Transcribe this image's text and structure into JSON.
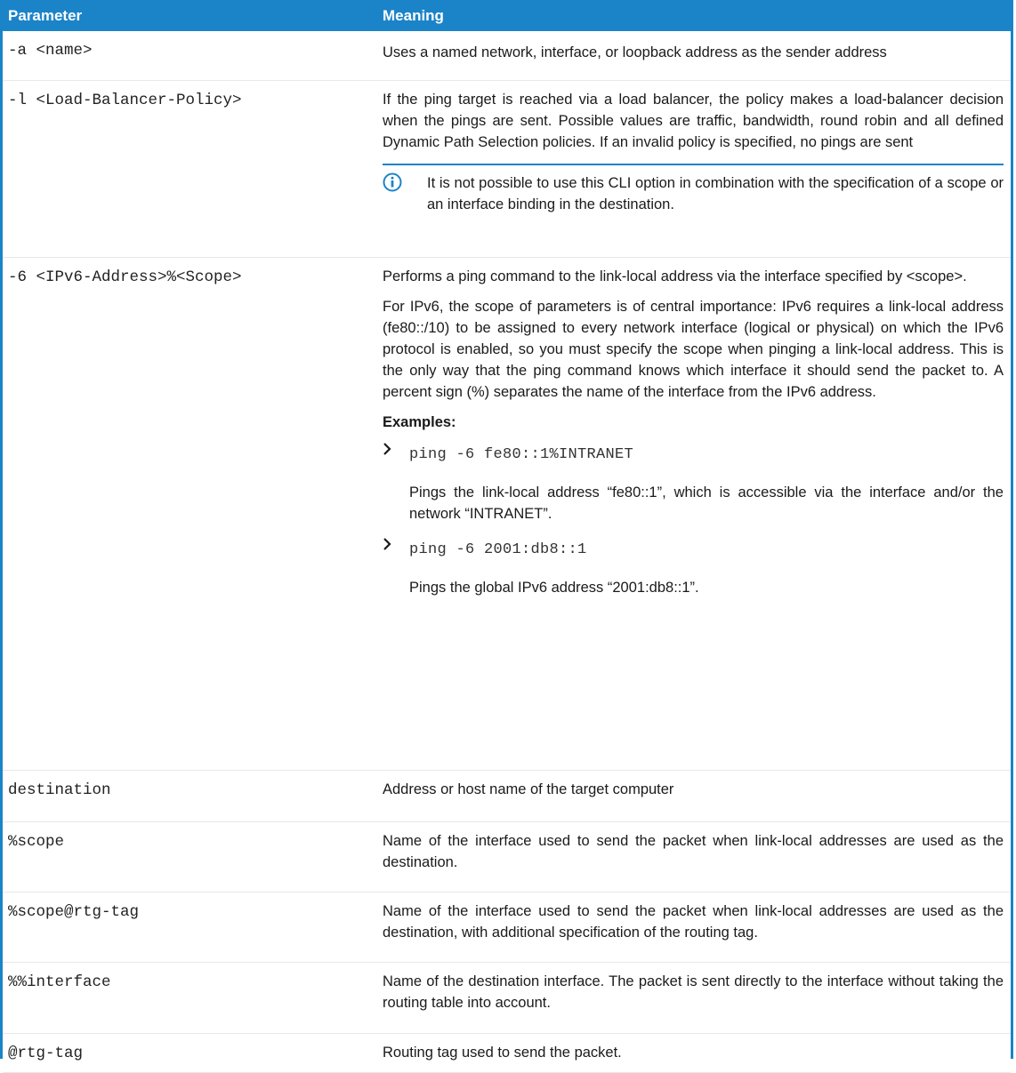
{
  "header": {
    "col1": "Parameter",
    "col2": "Meaning"
  },
  "rows": [
    {
      "param": "-a <name>",
      "meaning": "Uses a named network, interface, or loopback address as the sender address"
    },
    {
      "param": "-l <Load-Balancer-Policy>",
      "meaning": "If the ping target is reached via a load balancer, the policy makes a load-balancer decision when the pings are sent. Possible values are traffic, bandwidth, round robin and all defined Dynamic Path Selection policies. If an invalid policy is specified, no pings are sent",
      "note": "It is not possible to use this CLI option in combination with the specification of a scope or an interface binding in the destination."
    },
    {
      "param": "-6 <IPv6-Address>%<Scope>",
      "meaning": "Performs a ping command to the link-local address via the interface specified by <scope>.",
      "meaning2": "For IPv6, the scope of parameters is of central importance: IPv6 requires a link-local address (fe80::/10) to be assigned to every network interface (logical or physical) on which the IPv6 protocol is enabled, so you must specify the scope when pinging a link-local address. This is the only way that the ping command knows which interface it should send the packet to. A percent sign (%) separates the name of the interface from the IPv6 address.",
      "examples_label": "Examples:",
      "examples": [
        {
          "code": "ping -6 fe80::1%INTRANET",
          "desc": "Pings the link-local address “fe80::1”, which is accessible via the interface and/or the network “INTRANET”."
        },
        {
          "code": "ping -6 2001:db8::1",
          "desc": "Pings the global IPv6 address “2001:db8::1”."
        }
      ]
    },
    {
      "param": "destination",
      "meaning": "Address or host name of the target computer"
    },
    {
      "param": "%scope",
      "meaning": "Name of the interface used to send the packet when link-local addresses are used as the destination."
    },
    {
      "param": "%scope@rtg-tag",
      "meaning": "Name of the interface used to send the packet when link-local addresses are used as the destination, with additional specification of the routing tag."
    },
    {
      "param": "%%interface",
      "meaning": "Name of the destination interface. The packet is sent directly to the interface without taking the routing table into account."
    },
    {
      "param": "@rtg-tag",
      "meaning": "Routing tag used to send the packet."
    }
  ],
  "icons": {
    "note": "info-icon",
    "bullet": "chevron-right-icon"
  },
  "colors": {
    "accent": "#1b84c8"
  }
}
